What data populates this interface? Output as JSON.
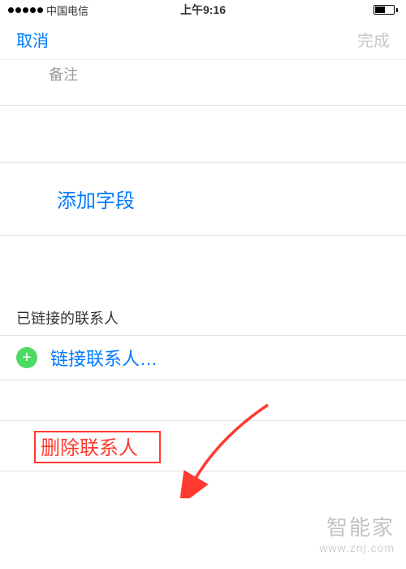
{
  "status_bar": {
    "carrier": "中国电信",
    "time": "上午9:16"
  },
  "nav": {
    "cancel": "取消",
    "done": "完成"
  },
  "truncated_field": "备注",
  "add_field": "添加字段",
  "linked_section": {
    "header": "已链接的联系人",
    "link_action": "链接联系人…"
  },
  "delete_action": "删除联系人",
  "watermark": {
    "brand": "智能家",
    "url": "www.znj.com"
  }
}
